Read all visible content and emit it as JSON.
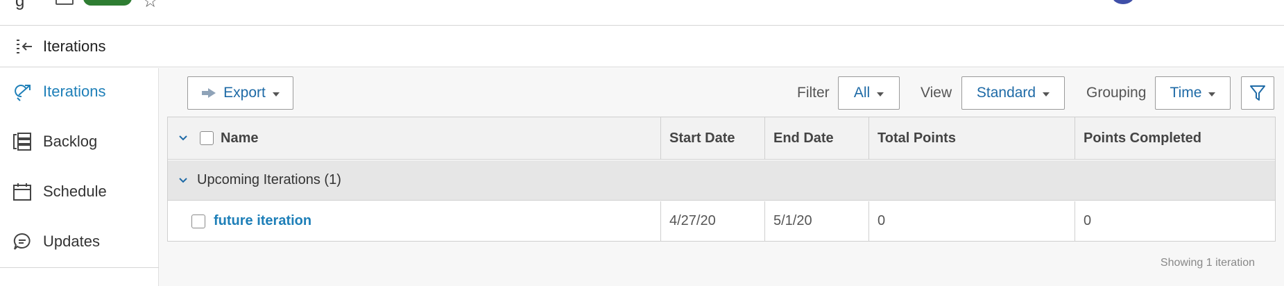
{
  "subheader": {
    "title": "Iterations"
  },
  "sidebar": {
    "items": [
      {
        "label": "Iterations",
        "icon": "iterations-icon",
        "active": true
      },
      {
        "label": "Backlog",
        "icon": "backlog-icon"
      },
      {
        "label": "Schedule",
        "icon": "calendar-icon"
      },
      {
        "label": "Updates",
        "icon": "chat-bubble-icon"
      }
    ]
  },
  "toolbar": {
    "export_label": "Export",
    "filter_label": "Filter",
    "filter_value": "All",
    "view_label": "View",
    "view_value": "Standard",
    "grouping_label": "Grouping",
    "grouping_value": "Time"
  },
  "table": {
    "columns": [
      "Name",
      "Start Date",
      "End Date",
      "Total Points",
      "Points Completed"
    ],
    "group": {
      "label": "Upcoming Iterations (1)"
    },
    "rows": [
      {
        "name": "future iteration",
        "start": "4/27/20",
        "end": "5/1/20",
        "total": "0",
        "completed": "0"
      }
    ]
  },
  "footer": {
    "text": "Showing 1 iteration"
  },
  "colors": {
    "accent": "#1e7fb8",
    "active_sidebar": "#1e7fb8",
    "group_bg": "#e6e6e6"
  }
}
